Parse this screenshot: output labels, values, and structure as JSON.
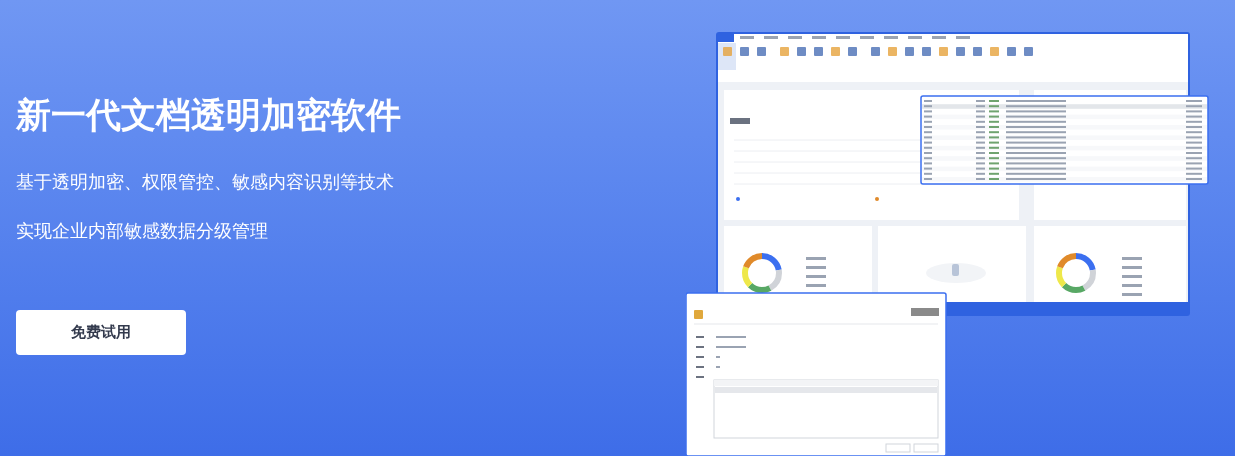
{
  "hero": {
    "title": "新一代文档透明加密软件",
    "lines": [
      "基于透明加密、权限管控、敏感内容识别等技术",
      "实现企业内部敏感数据分级管理"
    ],
    "button": "免费试用"
  }
}
